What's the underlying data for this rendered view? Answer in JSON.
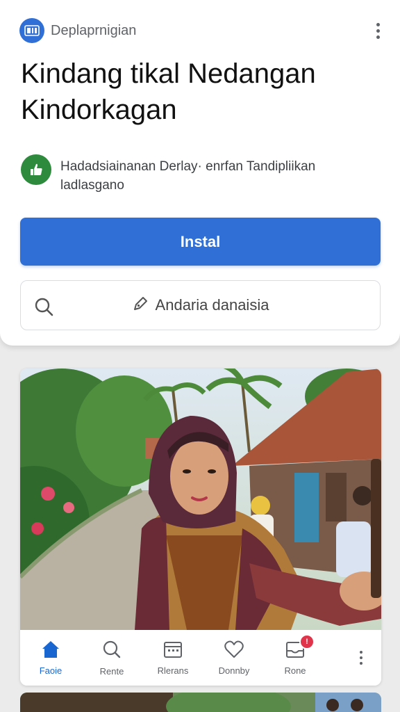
{
  "header": {
    "app_name": "Deplaprnigian",
    "icon": "app-logo-icon",
    "menu_icon": "more-vert-icon"
  },
  "title": "Kindang tikal Nedangan Kindorkagan",
  "promo": {
    "icon": "thumbs-up-icon",
    "text": "Hadadsiainanan Derlay· enrfan Tandipliikan ladlasgano"
  },
  "install_button": {
    "label": "Instal"
  },
  "search": {
    "icon": "search-icon",
    "action_icon": "share-pencil-icon",
    "label": "Andaria danaisia"
  },
  "photo_card": {
    "image": "woman-in-hijab-village-photo",
    "nav": [
      {
        "label": "Faоie",
        "icon": "home-icon",
        "active": true
      },
      {
        "label": "Rente",
        "icon": "search-icon",
        "active": false
      },
      {
        "label": "Rlerans",
        "icon": "calendar-icon",
        "active": false
      },
      {
        "label": "Donnby",
        "icon": "heart-icon",
        "active": false
      },
      {
        "label": "Rone",
        "icon": "inbox-icon",
        "active": false,
        "badge": "!"
      }
    ],
    "more_icon": "more-vert-icon"
  },
  "colors": {
    "accent": "#2f6fd6",
    "promo_green": "#2e8b3e",
    "badge_red": "#e0344a",
    "background": "#ebebeb"
  }
}
